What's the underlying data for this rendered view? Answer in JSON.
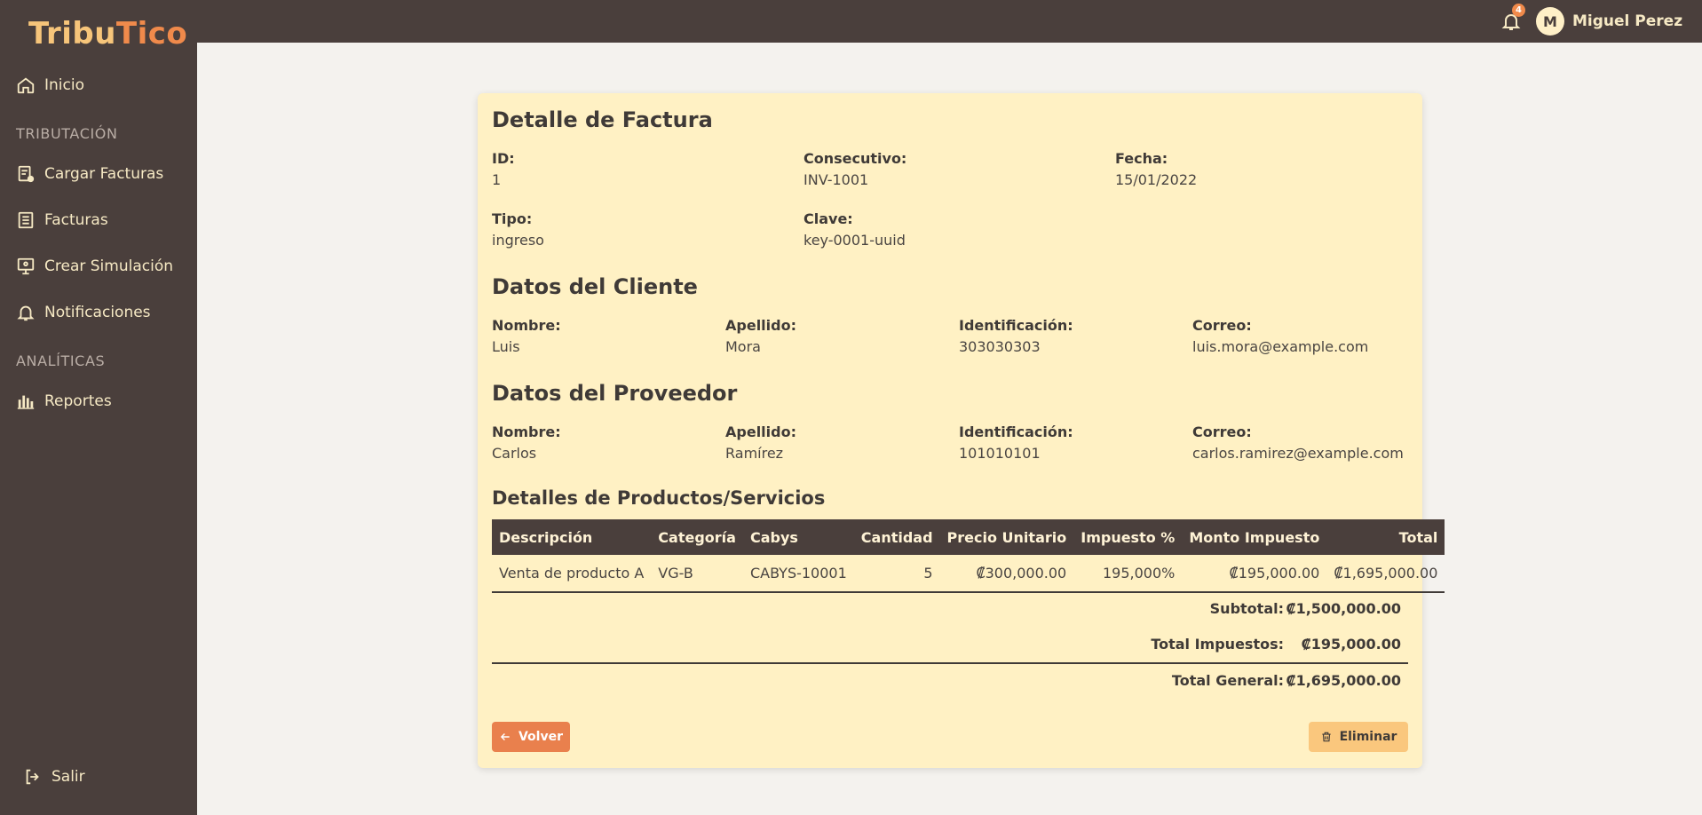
{
  "brand": {
    "part1": "Tribu",
    "part2": "Tico"
  },
  "sidebar": {
    "items": [
      {
        "label": "Inicio",
        "icon": "home-icon"
      },
      {
        "label": "Cargar Facturas",
        "icon": "upload-invoice-icon"
      },
      {
        "label": "Facturas",
        "icon": "list-icon"
      },
      {
        "label": "Crear Simulación",
        "icon": "simulation-icon"
      },
      {
        "label": "Notificaciones",
        "icon": "bell-icon"
      },
      {
        "label": "Reportes",
        "icon": "bar-chart-icon"
      }
    ],
    "sections": [
      "TRIBUTACIÓN",
      "ANALÍTICAS"
    ],
    "logout": "Salir"
  },
  "header": {
    "notification_count": "4",
    "user_initial": "M",
    "user_name": "Miguel Perez"
  },
  "invoice": {
    "title": "Detalle de Factura",
    "id_label": "ID:",
    "id": "1",
    "consecutivo_label": "Consecutivo:",
    "consecutivo": "INV-1001",
    "fecha_label": "Fecha:",
    "fecha": "15/01/2022",
    "tipo_label": "Tipo:",
    "tipo": "ingreso",
    "clave_label": "Clave:",
    "clave": "key-0001-uuid"
  },
  "cliente": {
    "title": "Datos del Cliente",
    "nombre_label": "Nombre:",
    "nombre": "Luis",
    "apellido_label": "Apellido:",
    "apellido": "Mora",
    "identificacion_label": "Identificación:",
    "identificacion": "303030303",
    "correo_label": "Correo:",
    "correo": "luis.mora@example.com"
  },
  "proveedor": {
    "title": "Datos del Proveedor",
    "nombre_label": "Nombre:",
    "nombre": "Carlos",
    "apellido_label": "Apellido:",
    "apellido": "Ramírez",
    "identificacion_label": "Identificación:",
    "identificacion": "101010101",
    "correo_label": "Correo:",
    "correo": "carlos.ramirez@example.com"
  },
  "productos": {
    "title": "Detalles de Productos/Servicios",
    "columns": [
      "Descripción",
      "Categoría",
      "Cabys",
      "Cantidad",
      "Precio Unitario",
      "Impuesto %",
      "Monto Impuesto",
      "Total"
    ],
    "rows": [
      [
        "Venta de producto A",
        "VG-B",
        "CABYS-10001",
        "5",
        "₡300,000.00",
        "195,000%",
        "₡195,000.00",
        "₡1,695,000.00"
      ]
    ],
    "subtotal_label": "Subtotal:",
    "subtotal": "₡1,500,000.00",
    "impuestos_label": "Total Impuestos:",
    "impuestos": "₡195,000.00",
    "general_label": "Total General:",
    "general": "₡1,695,000.00"
  },
  "actions": {
    "back": "Volver",
    "delete": "Eliminar"
  },
  "colors": {
    "sidebar": "#4a3f3c",
    "card": "#fff1c4",
    "accent": "#e9804d",
    "danger_soft": "#fac77d"
  }
}
